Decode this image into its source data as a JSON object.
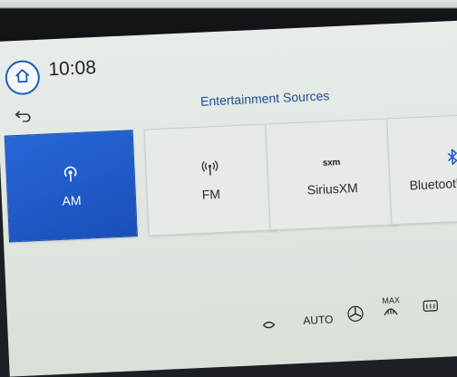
{
  "status": {
    "time": "10:08"
  },
  "header": {
    "title": "Entertainment Sources"
  },
  "sources": [
    {
      "label": "AM",
      "icon": "broadcast-icon",
      "selected": true
    },
    {
      "label": "FM",
      "icon": "radio-tower-icon",
      "selected": false
    },
    {
      "label": "SiriusXM",
      "icon": "siriusxm-logo-icon",
      "selected": false,
      "logo_text": "sxm"
    },
    {
      "label": "Bluetooth Audio",
      "icon": "bluetooth-icon",
      "selected": false
    }
  ],
  "climate_bar": {
    "auto_label": "AUTO",
    "max_label": "MAX"
  },
  "colors": {
    "accent": "#1f5bd0",
    "heading": "#1f4f92",
    "tile_bg": "#e6ebe6"
  }
}
